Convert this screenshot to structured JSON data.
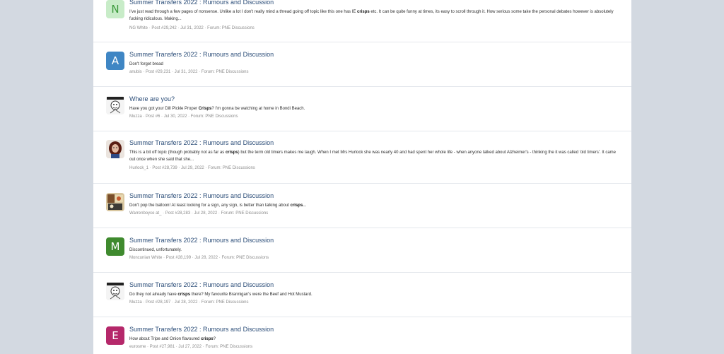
{
  "results": [
    {
      "avatar_letter": "N",
      "avatar_color": "#c8ecc8",
      "avatar_text_color": "#3c9a3c",
      "title": "Summer Transfers 2022 : Rumours and Discussion",
      "snippet_before": "I've just read through a few pages of nonsense. Unlike a lot I don't really mind a thread going off topic like this one has IE ",
      "snippet_bold": "crisps",
      "snippet_after": " etc. It can be quite funny at times, its easy to scroll through it. How serious some take the personal debates however is absolutely fucking ridiculous. Making...",
      "author": "NG White",
      "post": "Post #29,242",
      "date": "Jul 31, 2022",
      "forum": "Forum: PNE Discussions"
    },
    {
      "avatar_letter": "A",
      "avatar_color": "#3f86c4",
      "avatar_text_color": "#ffffff",
      "title": "Summer Transfers 2022 : Rumours and Discussion",
      "snippet_before": "Don't forget bread",
      "snippet_bold": "",
      "snippet_after": "",
      "author": "anubis",
      "post": "Post #29,231",
      "date": "Jul 31, 2022",
      "forum": "Forum: PNE Discussions"
    },
    {
      "avatar_icon": "mascot-sticker-icon",
      "title": "Where are you?",
      "snippet_before": "Have you got your Dill Pickle Proper ",
      "snippet_bold": "Crisps",
      "snippet_after": "? I'm gonna be watching at home in Bondi Beach.",
      "author": "Muzza",
      "post": "Post #6",
      "date": "Jul 30, 2022",
      "forum": "Forum: PNE Discussions"
    },
    {
      "avatar_icon": "person-portrait-icon",
      "title": "Summer Transfers 2022 : Rumours and Discussion",
      "snippet_before": "This is a bit off topic (though probably not as far as ",
      "snippet_bold": "crisps",
      "snippet_after": ") but the term old timers makes me laugh. When I met Mrs Hurlock she was nearly 40 and had spent her whole life - when anyone talked about Alzheimer's - thinking the it was called 'old timers'. It came out once when she said that she...",
      "author": "Hurlock_1",
      "post": "Post #28,739",
      "date": "Jul 29, 2022",
      "forum": "Forum: PNE Discussions"
    },
    {
      "avatar_icon": "comic-art-icon",
      "title": "Summer Transfers 2022 : Rumours and Discussion",
      "snippet_before": "Don't pop the balloon! At least looking for a sign, any sign, is better than talking about ",
      "snippet_bold": "crisps",
      "snippet_after": "...",
      "author": "Warrenboyce at_",
      "post": "Post #28,283",
      "date": "Jul 28, 2022",
      "forum": "Forum: PNE Discussions"
    },
    {
      "avatar_letter": "M",
      "avatar_color": "#3f8a2e",
      "avatar_text_color": "#ffffff",
      "title": "Summer Transfers 2022 : Rumours and Discussion",
      "snippet_before": "Discontinued, unfortunately.",
      "snippet_bold": "",
      "snippet_after": "",
      "author": "Moncunian White",
      "post": "Post #28,199",
      "date": "Jul 28, 2022",
      "forum": "Forum: PNE Discussions"
    },
    {
      "avatar_icon": "mascot-sticker-icon",
      "title": "Summer Transfers 2022 : Rumours and Discussion",
      "snippet_before": "Do they not already have ",
      "snippet_bold": "crisps",
      "snippet_after": " there? My favourite Brannigan's were the Beef and Hot Mustard.",
      "author": "Muzza",
      "post": "Post #28,197",
      "date": "Jul 28, 2022",
      "forum": "Forum: PNE Discussions"
    },
    {
      "avatar_letter": "E",
      "avatar_color": "#b5286a",
      "avatar_text_color": "#ffffff",
      "title": "Summer Transfers 2022 : Rumours and Discussion",
      "snippet_before": "How about Tripe and Onion flavoured ",
      "snippet_bold": "crisps",
      "snippet_after": "?",
      "author": "eurosme",
      "post": "Post #27,981",
      "date": "Jul 27, 2022",
      "forum": "Forum: PNE Discussions"
    }
  ],
  "separator": " · "
}
